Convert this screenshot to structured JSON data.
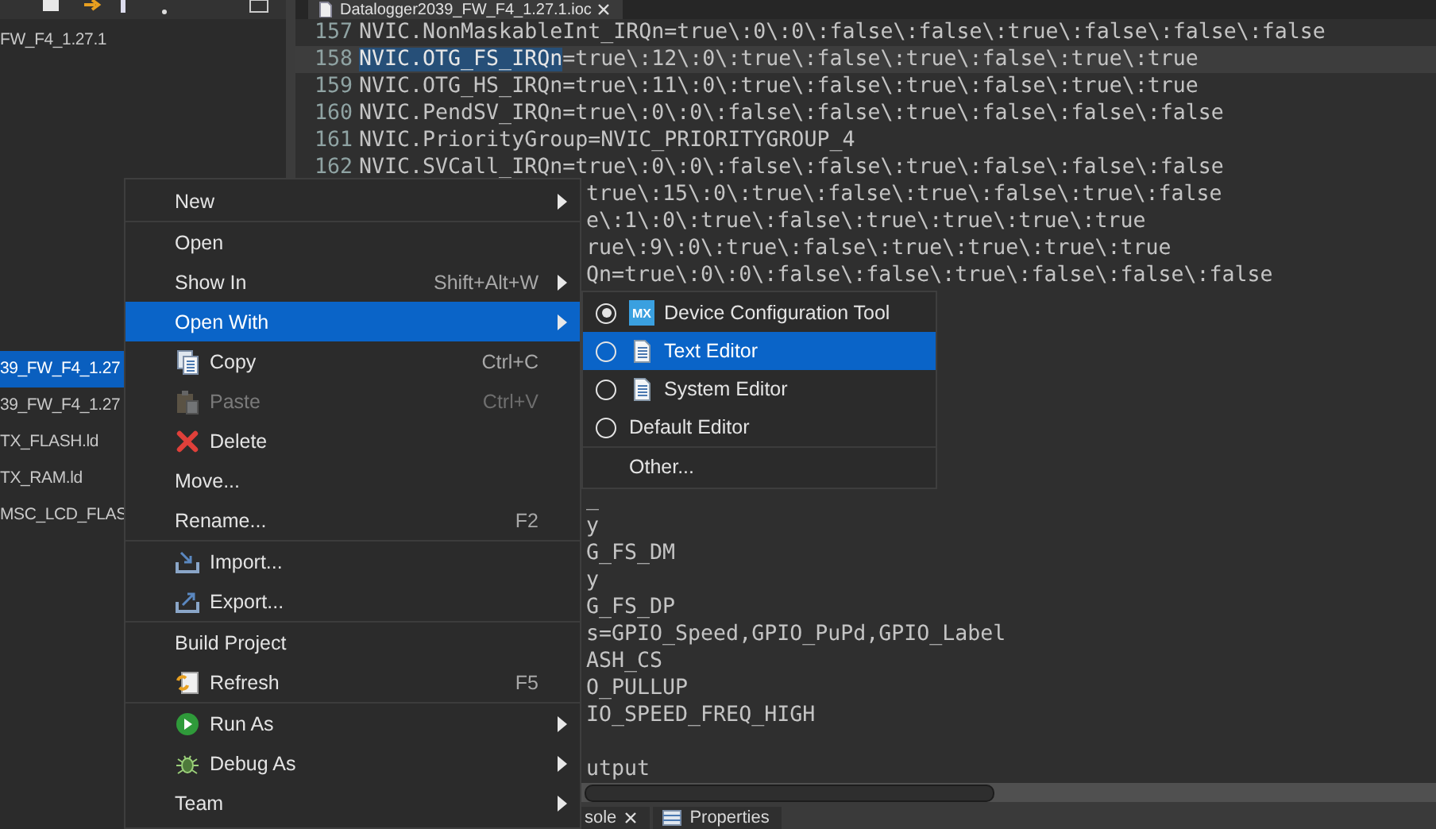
{
  "explorer": {
    "root": {
      "label": "FW_F4_1.27.1",
      "selected": false
    },
    "items": [
      {
        "label": "39_FW_F4_1.27",
        "selected": true
      },
      {
        "label": "39_FW_F4_1.27",
        "selected": false
      },
      {
        "label": "TX_FLASH.ld",
        "selected": false
      },
      {
        "label": "TX_RAM.ld",
        "selected": false
      },
      {
        "label": "MSC_LCD_FLAS",
        "selected": false
      }
    ]
  },
  "editor": {
    "tab": {
      "title": "Datalogger2039_FW_F4_1.27.1.ioc"
    },
    "lines": [
      {
        "number": "157",
        "text": "NVIC.NonMaskableInt_IRQn=true\\:0\\:0\\:false\\:false\\:true\\:false\\:false\\:false",
        "current": false
      },
      {
        "number": "158",
        "selection": "NVIC.OTG_FS_IRQn",
        "text": "=true\\:12\\:0\\:true\\:false\\:true\\:false\\:true\\:true",
        "current": true
      },
      {
        "number": "159",
        "text": "NVIC.OTG_HS_IRQn=true\\:11\\:0\\:true\\:false\\:true\\:false\\:true\\:true",
        "current": false
      },
      {
        "number": "160",
        "text": "NVIC.PendSV_IRQn=true\\:0\\:0\\:false\\:false\\:true\\:false\\:false\\:false",
        "current": false
      },
      {
        "number": "161",
        "text": "NVIC.PriorityGroup=NVIC_PRIORITYGROUP_4",
        "current": false
      },
      {
        "number": "162",
        "text": "NVIC.SVCall_IRQn=true\\:0\\:0\\:false\\:false\\:true\\:false\\:false\\:false",
        "current": false
      }
    ],
    "beside_menu": [
      "true\\:15\\:0\\:true\\:false\\:true\\:false\\:true\\:false",
      "e\\:1\\:0\\:true\\:false\\:true\\:true\\:true\\:true",
      "rue\\:9\\:0\\:true\\:false\\:true\\:true\\:true\\:true",
      "Qn=true\\:0\\:0\\:false\\:false\\:true\\:false\\:false\\:false"
    ],
    "below_submenu": [
      "_",
      "y",
      "G_FS_DM",
      "y",
      "G_FS_DP",
      "s=GPIO_Speed,GPIO_PuPd,GPIO_Label",
      "ASH_CS",
      "O_PULLUP",
      "IO_SPEED_FREQ_HIGH"
    ],
    "last_fragment": "utput"
  },
  "bottom_tabs": [
    {
      "label": "sole",
      "closable": true
    },
    {
      "label": "Properties",
      "closable": false
    }
  ],
  "context_menu": {
    "items": [
      {
        "kind": "submenu",
        "label": "New",
        "selected": false,
        "disabled": false
      },
      {
        "kind": "separator"
      },
      {
        "kind": "command",
        "label": "Open",
        "selected": false,
        "disabled": false
      },
      {
        "kind": "submenu",
        "label": "Show In",
        "shortcut": "Shift+Alt+W",
        "selected": false,
        "disabled": false
      },
      {
        "kind": "submenu",
        "label": "Open With",
        "selected": true,
        "disabled": false
      },
      {
        "kind": "command",
        "label": "Copy",
        "shortcut": "Ctrl+C",
        "selected": false,
        "disabled": false
      },
      {
        "kind": "command",
        "label": "Paste",
        "shortcut": "Ctrl+V",
        "selected": false,
        "disabled": true
      },
      {
        "kind": "command",
        "label": "Delete",
        "selected": false,
        "disabled": false
      },
      {
        "kind": "command",
        "label": "Move...",
        "selected": false,
        "disabled": false
      },
      {
        "kind": "command",
        "label": "Rename...",
        "shortcut": "F2",
        "selected": false,
        "disabled": false
      },
      {
        "kind": "separator"
      },
      {
        "kind": "command",
        "label": "Import...",
        "selected": false,
        "disabled": false
      },
      {
        "kind": "command",
        "label": "Export...",
        "selected": false,
        "disabled": false
      },
      {
        "kind": "separator"
      },
      {
        "kind": "command",
        "label": "Build Project",
        "selected": false,
        "disabled": false
      },
      {
        "kind": "command",
        "label": "Refresh",
        "shortcut": "F5",
        "selected": false,
        "disabled": false
      },
      {
        "kind": "separator"
      },
      {
        "kind": "submenu",
        "label": "Run As",
        "selected": false,
        "disabled": false
      },
      {
        "kind": "submenu",
        "label": "Debug As",
        "selected": false,
        "disabled": false
      },
      {
        "kind": "submenu",
        "label": "Team",
        "selected": false,
        "disabled": false
      }
    ]
  },
  "open_with_menu": {
    "items": [
      {
        "kind": "radio",
        "badge": "MX",
        "label": "Device Configuration Tool",
        "checked": true,
        "selected": false
      },
      {
        "kind": "radio",
        "label": "Text Editor",
        "checked": false,
        "selected": true
      },
      {
        "kind": "radio",
        "label": "System Editor",
        "checked": false,
        "selected": false
      },
      {
        "kind": "radio",
        "label": "Default Editor",
        "checked": false,
        "selected": false
      },
      {
        "kind": "separator"
      },
      {
        "kind": "command",
        "label": "Other...",
        "selected": false
      }
    ]
  }
}
